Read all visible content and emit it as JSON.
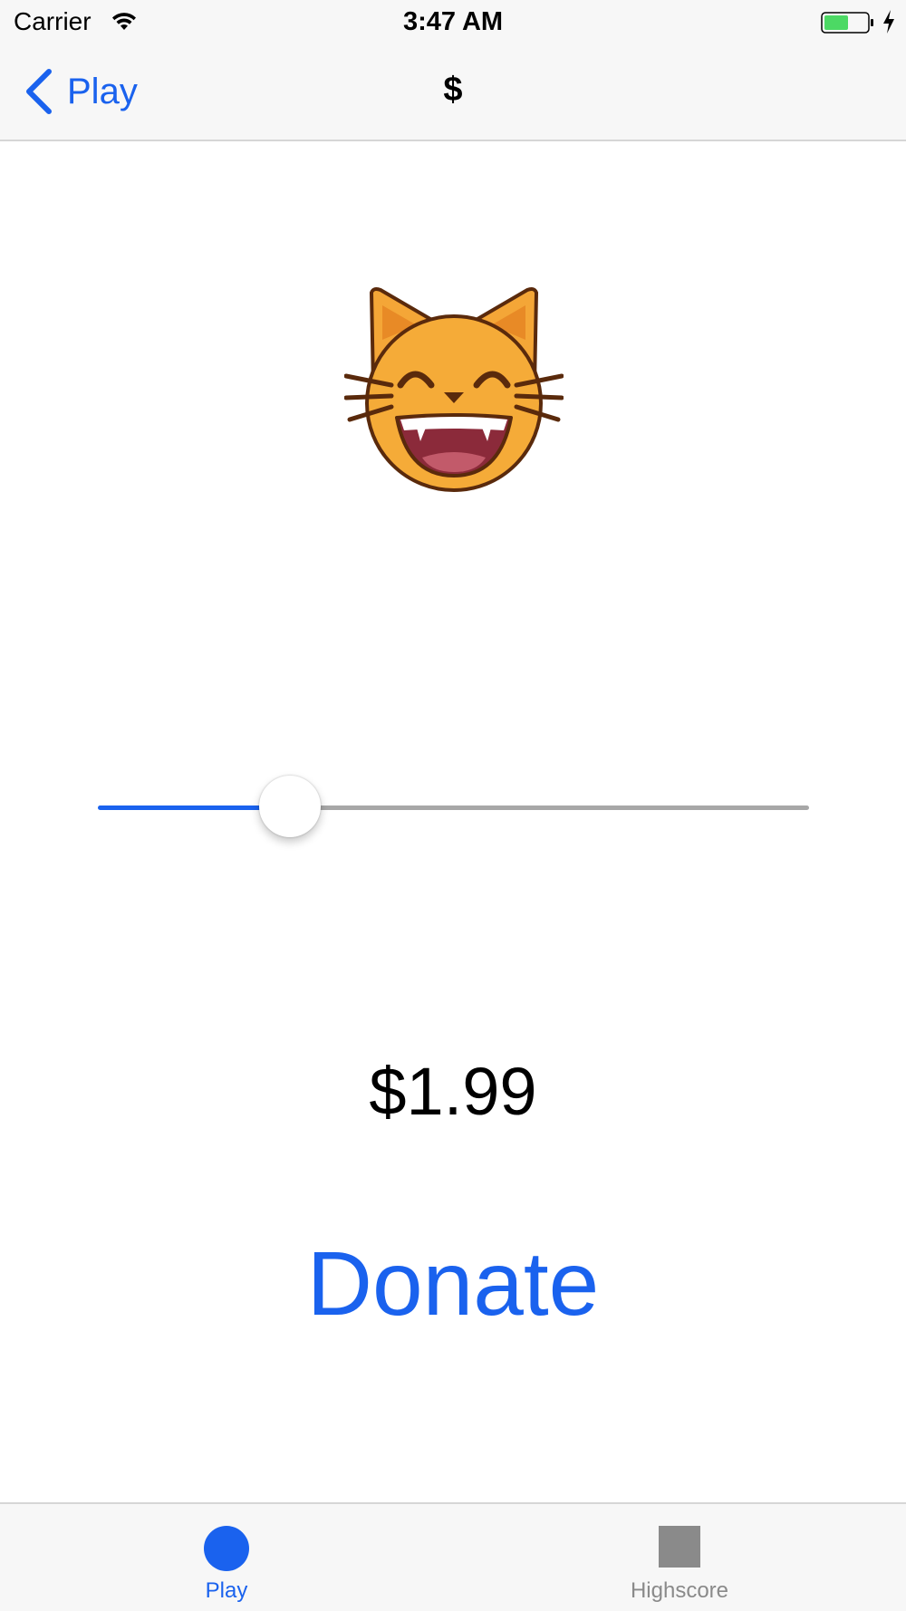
{
  "status_bar": {
    "carrier": "Carrier",
    "time": "3:47 AM",
    "battery_color": "#4cd964"
  },
  "nav_bar": {
    "back_label": "Play",
    "title": "$"
  },
  "content": {
    "emoji": "smiling-cat-emoji",
    "slider_fraction": 0.27,
    "price": "$1.99",
    "donate_label": "Donate"
  },
  "tab_bar": {
    "tabs": [
      {
        "label": "Play",
        "icon": "circle-icon",
        "selected": true
      },
      {
        "label": "Highscore",
        "icon": "square-icon",
        "selected": false
      }
    ]
  },
  "colors": {
    "accent": "#1a62ee",
    "inactive": "#8a8a8a",
    "bar_background": "#f7f7f7"
  }
}
